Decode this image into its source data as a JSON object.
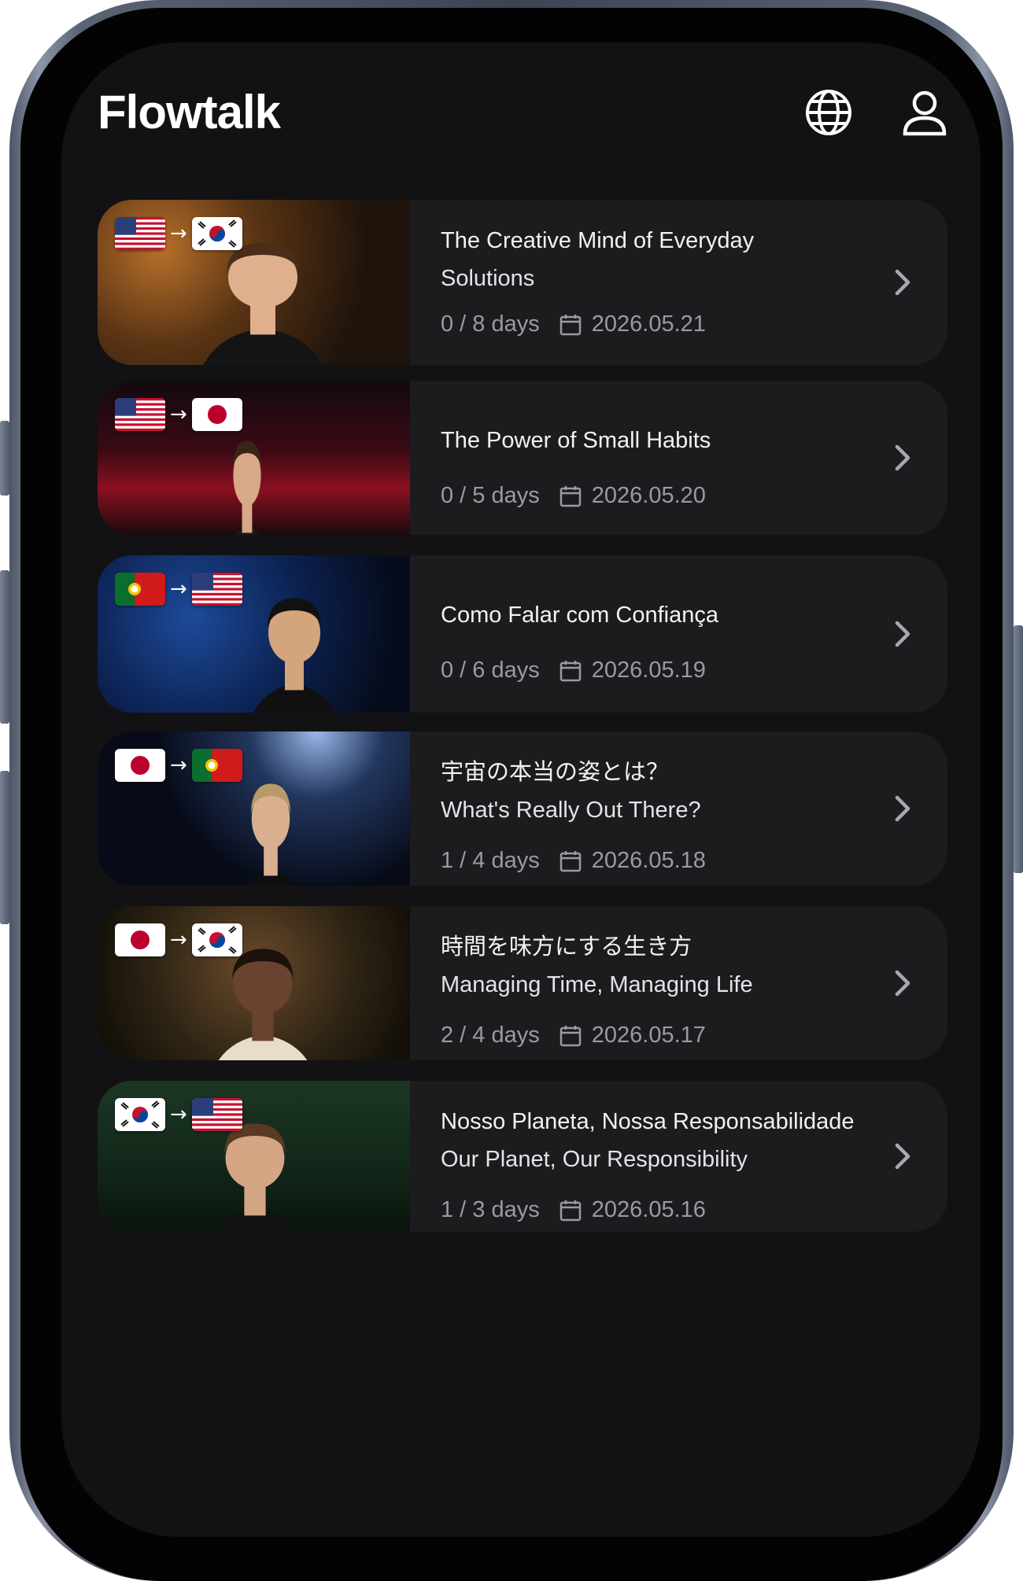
{
  "app": {
    "title": "Flowtalk"
  },
  "header": {
    "language_icon": "globe-icon",
    "profile_icon": "user-icon"
  },
  "courses": [
    {
      "from": "us",
      "to": "kr",
      "title_line1": "The Creative Mind of Everyday",
      "title_line2": "Solutions",
      "progress": "0 / 8 days",
      "date": "2026.05.21",
      "thumb": "man-black-sweater-studio"
    },
    {
      "from": "us",
      "to": "jp",
      "title_line1": "The Power of Small Habits",
      "title_line2": "",
      "progress": "0 / 5 days",
      "date": "2026.05.20",
      "thumb": "woman-on-red-stage"
    },
    {
      "from": "pt",
      "to": "us",
      "title_line1": "Como Falar com Confiança",
      "title_line2": "",
      "progress": "0 / 6 days",
      "date": "2026.05.19",
      "thumb": "man-on-blue-stage"
    },
    {
      "from": "jp",
      "to": "pt",
      "title_line1": "宇宙の本当の姿とは？",
      "title_line2": "What's Really Out There?",
      "progress": "1 / 4 days",
      "date": "2026.05.18",
      "thumb": "woman-space-earth"
    },
    {
      "from": "jp",
      "to": "kr",
      "title_line1": "時間を味方にする生き方",
      "title_line2": "Managing Time, Managing Life",
      "progress": "2 / 4 days",
      "date": "2026.05.17",
      "thumb": "woman-seated-plants"
    },
    {
      "from": "kr",
      "to": "us",
      "title_line1": "Nosso Planeta, Nossa Responsabilidade",
      "title_line2": "Our Planet, Our Responsibility",
      "progress": "1 / 3 days",
      "date": "2026.05.16",
      "thumb": "man-suit-podium"
    }
  ]
}
